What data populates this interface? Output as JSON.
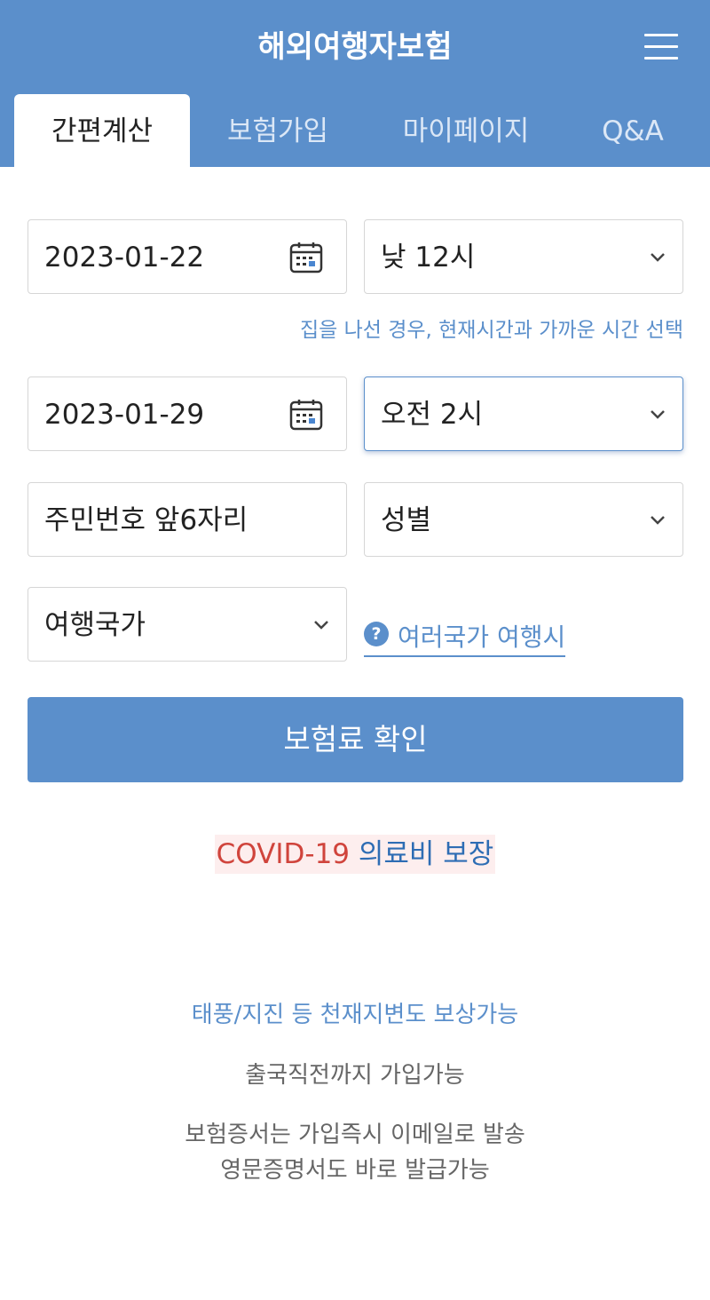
{
  "header": {
    "title": "해외여행자보험",
    "menu_icon": "hamburger-menu-icon"
  },
  "tabs": [
    {
      "label": "간편계산",
      "active": true
    },
    {
      "label": "보험가입",
      "active": false
    },
    {
      "label": "마이페이지",
      "active": false
    },
    {
      "label": "Q&A",
      "active": false
    }
  ],
  "form": {
    "depart_date": "2023-01-22",
    "depart_time": "낮 12시",
    "depart_hint": "집을 나선 경우, 현재시간과 가까운 시간 선택",
    "return_date": "2023-01-29",
    "return_time": "오전 2시",
    "birth_placeholder": "주민번호 앞6자리",
    "gender_placeholder": "성별",
    "country_placeholder": "여행국가",
    "multi_country_link": "여러국가 여행시",
    "submit_label": "보험료 확인"
  },
  "promo": {
    "covid_red": "COVID-19",
    "covid_blue": "의료비 보장",
    "feature1": "태풍/지진 등 천재지변도 보상가능",
    "feature2": "출국직전까지 가입가능",
    "feature3_line1": "보험증서는 가입즉시 이메일로 발송",
    "feature3_line2": "영문증명서도 바로 발급가능"
  },
  "colors": {
    "primary": "#5b8fcb",
    "covid_red": "#d0443c",
    "covid_blue": "#2e6db4"
  }
}
